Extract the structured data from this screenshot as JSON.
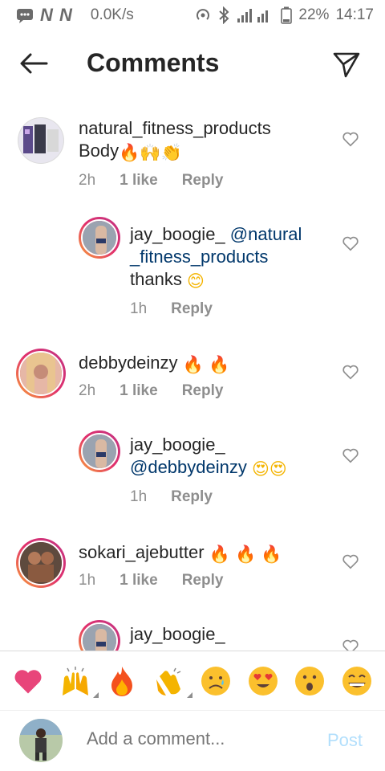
{
  "status_bar": {
    "network_marks": "N N",
    "speed": "0.0K/s",
    "battery": "22%",
    "time": "14:17"
  },
  "header": {
    "title": "Comments"
  },
  "comments": [
    {
      "user": "natural_fitness_products",
      "body": "Body",
      "time": "2h",
      "likes": "1 like",
      "reply": "Reply"
    },
    {
      "user": "jay_boogie_",
      "mention_line1": "@natural",
      "mention_line2": "_fitness_products",
      "body": "thanks",
      "time": "1h",
      "reply": "Reply"
    },
    {
      "user": "debbydeinzy",
      "time": "2h",
      "likes": "1 like",
      "reply": "Reply"
    },
    {
      "user": "jay_boogie_",
      "mention": "@debbydeinzy",
      "time": "1h",
      "reply": "Reply"
    },
    {
      "user": "sokari_ajebutter",
      "time": "1h",
      "likes": "1 like",
      "reply": "Reply"
    },
    {
      "user": "jay_boogie_"
    }
  ],
  "reactions": [
    "heart",
    "raised-hands",
    "fire",
    "clapping-hands",
    "sad-face",
    "heart-eyes-face",
    "surprised-face",
    "grinning-face"
  ],
  "composer": {
    "placeholder": "Add a comment...",
    "post_label": "Post",
    "post_color": "#b2dffc"
  },
  "colors": {
    "story_ring_start": "#f9a338",
    "story_ring_end": "#c13584",
    "mention": "#00376b",
    "meta_gray": "#8e8e8e"
  }
}
